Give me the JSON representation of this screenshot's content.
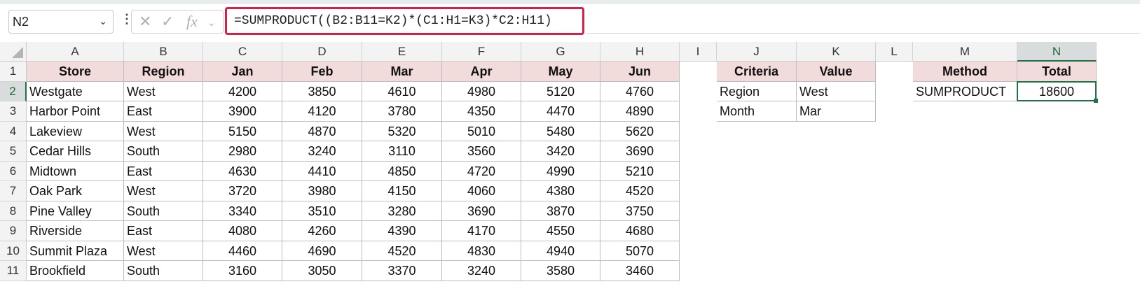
{
  "name_box": {
    "value": "N2"
  },
  "formula": {
    "text": "=SUMPRODUCT((B2:B11=K2)*(C1:H1=K3)*C2:H11)"
  },
  "columns": [
    "A",
    "B",
    "C",
    "D",
    "E",
    "F",
    "G",
    "H",
    "I",
    "J",
    "K",
    "L",
    "M",
    "N"
  ],
  "selected_column": "N",
  "rows": [
    "1",
    "2",
    "3",
    "4",
    "5",
    "6",
    "7",
    "8",
    "9",
    "10",
    "11"
  ],
  "selected_row": "2",
  "sales_table": {
    "headers": [
      "Store",
      "Region",
      "Jan",
      "Feb",
      "Mar",
      "Apr",
      "May",
      "Jun"
    ],
    "rows": [
      [
        "Westgate",
        "West",
        "4200",
        "3850",
        "4610",
        "4980",
        "5120",
        "4760"
      ],
      [
        "Harbor Point",
        "East",
        "3900",
        "4120",
        "3780",
        "4350",
        "4470",
        "4890"
      ],
      [
        "Lakeview",
        "West",
        "5150",
        "4870",
        "5320",
        "5010",
        "5480",
        "5620"
      ],
      [
        "Cedar Hills",
        "South",
        "2980",
        "3240",
        "3110",
        "3560",
        "3420",
        "3690"
      ],
      [
        "Midtown",
        "East",
        "4630",
        "4410",
        "4850",
        "4720",
        "4990",
        "5210"
      ],
      [
        "Oak Park",
        "West",
        "3720",
        "3980",
        "4150",
        "4060",
        "4380",
        "4520"
      ],
      [
        "Pine Valley",
        "South",
        "3340",
        "3510",
        "3280",
        "3690",
        "3870",
        "3750"
      ],
      [
        "Riverside",
        "East",
        "4080",
        "4260",
        "4390",
        "4170",
        "4550",
        "4680"
      ],
      [
        "Summit Plaza",
        "West",
        "4460",
        "4690",
        "4520",
        "4830",
        "4940",
        "5070"
      ],
      [
        "Brookfield",
        "South",
        "3160",
        "3050",
        "3370",
        "3240",
        "3580",
        "3460"
      ]
    ]
  },
  "criteria_table": {
    "headers": [
      "Criteria",
      "Value"
    ],
    "rows": [
      [
        "Region",
        "West"
      ],
      [
        "Month",
        "Mar"
      ]
    ]
  },
  "result_table": {
    "headers": [
      "Method",
      "Total"
    ],
    "rows": [
      [
        "SUMPRODUCT",
        "18600"
      ]
    ]
  },
  "colors": {
    "header_fill": "#f2dcdb",
    "selection": "#217346",
    "formula_highlight": "#d6204a"
  }
}
